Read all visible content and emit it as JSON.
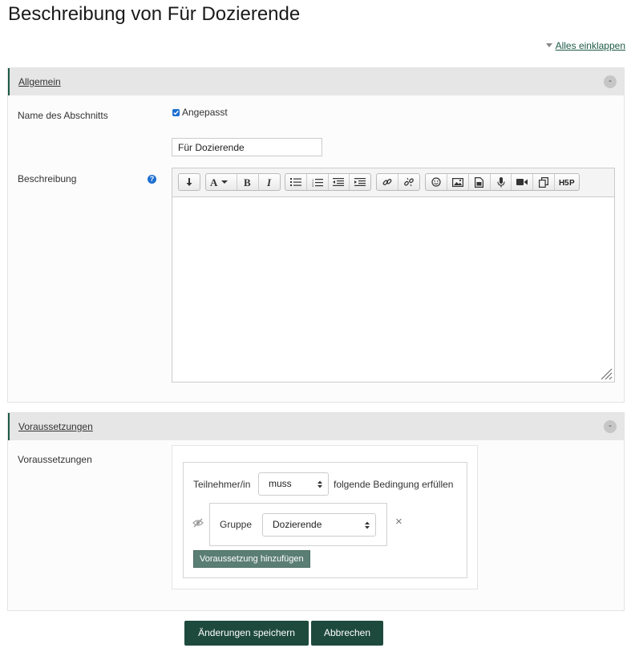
{
  "page": {
    "title": "Beschreibung von Für Dozierende"
  },
  "header": {
    "collapse_all_label": "Alles einklappen"
  },
  "general_section": {
    "legend": "Allgemein",
    "toggle_symbol": "-",
    "section_name": {
      "label": "Name des Abschnitts",
      "custom_checkbox_label": "Angepasst",
      "custom_checked": true,
      "value": "Für Dozierende"
    },
    "description": {
      "label": "Beschreibung",
      "help_icon_symbol": "?",
      "value": "",
      "toolbar_icons": [
        "collapse-toolbar-icon",
        "font-style-icon",
        "bold-icon",
        "italic-icon",
        "unordered-list-icon",
        "ordered-list-icon",
        "outdent-icon",
        "indent-icon",
        "link-icon",
        "unlink-icon",
        "emoji-icon",
        "image-icon",
        "media-icon",
        "record-audio-icon",
        "record-video-icon",
        "manage-files-icon",
        "h5p-icon"
      ]
    }
  },
  "restrictions_section": {
    "legend": "Voraussetzungen",
    "toggle_symbol": "-",
    "label": "Voraussetzungen",
    "participant_label": "Teilnehmer/in",
    "must_option": "muss",
    "condition_text": "folgende Bedingung erfüllen",
    "group_label": "Gruppe",
    "group_value": "Dozierende",
    "remove_symbol": "×",
    "add_button_label": "Voraussetzung hinzufügen"
  },
  "actions": {
    "save_label": "Änderungen speichern",
    "cancel_label": "Abbrechen"
  },
  "colors": {
    "brand": "#1e4a3d",
    "link": "#1d5a48",
    "checkbox": "#1d6fd1",
    "add_button": "#5b7e74"
  }
}
